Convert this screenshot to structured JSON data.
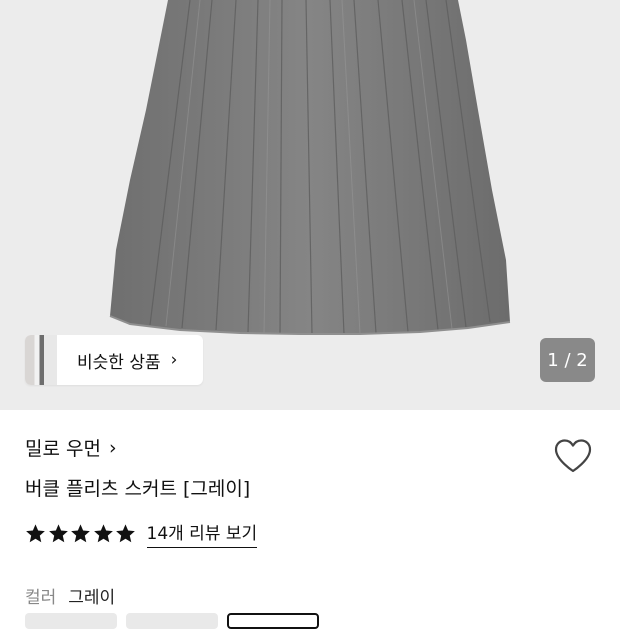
{
  "gallery": {
    "similar_button_label": "비슷한 상품",
    "page_indicator": "1 / 2",
    "current_image": 1,
    "total_images": 2
  },
  "product": {
    "brand": "밀로 우먼",
    "title": "버클 플리츠 스커트 [그레이]",
    "rating_stars": 5,
    "review_link": "14개 리뷰 보기"
  },
  "options": {
    "color_label": "컬러",
    "color_value": "그레이",
    "swatch_count": 3,
    "selected_swatch": 2
  },
  "icons": {
    "heart": "heart-outline-icon",
    "star": "star-filled-icon",
    "chevron": "chevron-right-icon"
  },
  "colors": {
    "skirt": "#7c7c7c",
    "hero_bg": "#ececec",
    "text": "#111111",
    "muted": "#888888"
  }
}
